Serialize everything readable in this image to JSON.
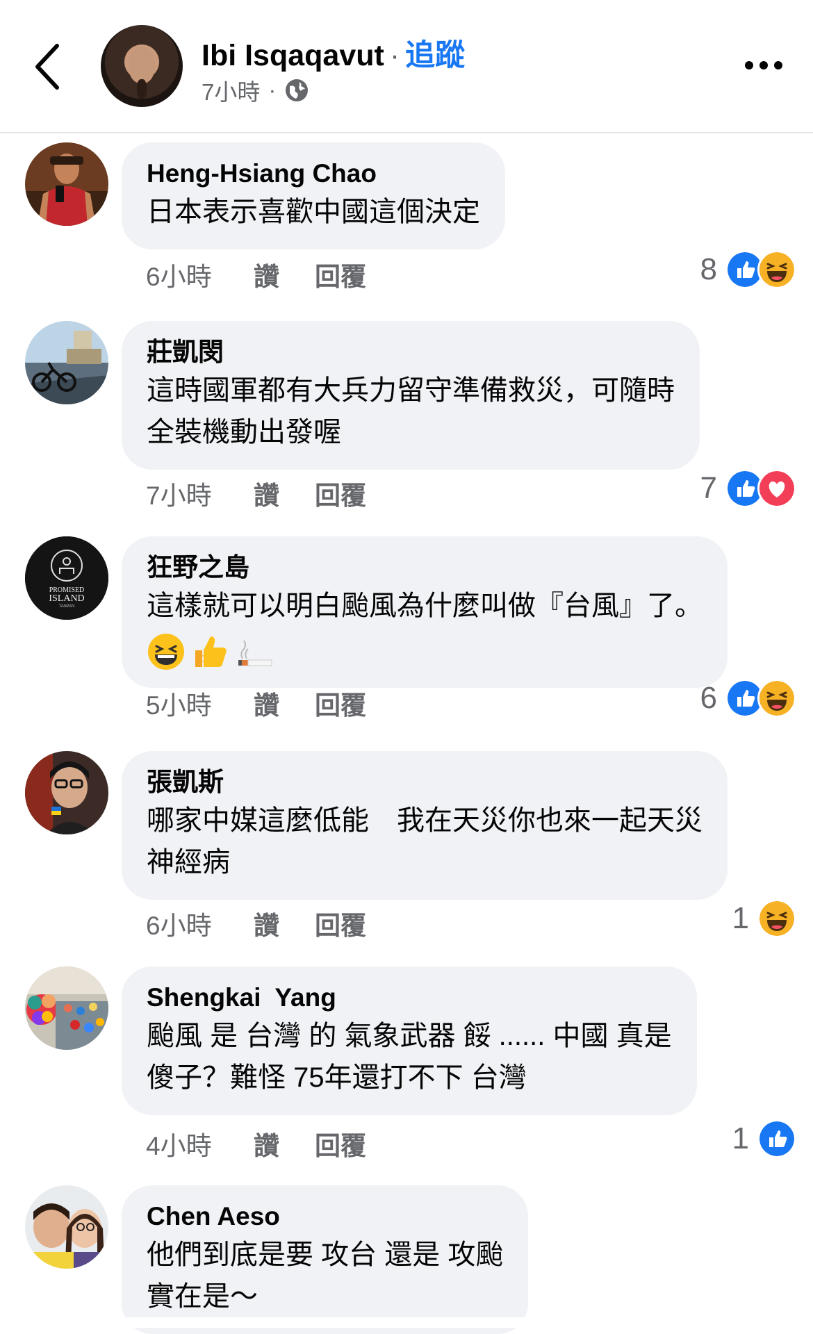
{
  "header": {
    "author": "Ibi Isqaqavut",
    "separator": "·",
    "follow_label": "追蹤",
    "time": "7小時",
    "meta_separator": "·"
  },
  "colors": {
    "accent": "#1877f2",
    "secondary_text": "#65676b",
    "bubble_bg": "#f0f2f5",
    "love_red": "#f33e58",
    "haha_yellow": "#f7b125"
  },
  "comments": [
    {
      "author": "Heng-Hsiang Chao",
      "lines": [
        "日本表示喜歡中國這個決定"
      ],
      "time": "6小時",
      "like_label": "讚",
      "reply_label": "回覆",
      "reaction_count": "8",
      "reactions": [
        "like-icon",
        "haha-icon"
      ]
    },
    {
      "author": "莊凱閔",
      "lines": [
        "這時國軍都有大兵力留守準備救災，可隨時",
        "全裝機動出發喔"
      ],
      "time": "7小時",
      "like_label": "讚",
      "reply_label": "回覆",
      "reaction_count": "7",
      "reactions": [
        "like-icon",
        "love-icon"
      ]
    },
    {
      "author": "狂野之島",
      "avatar_logo": {
        "line1": "PROMISED",
        "line2": "ISLAND",
        "line3": "TAIWAN"
      },
      "lines": [
        "這樣就可以明白颱風為什麼叫做『台風』了。"
      ],
      "emojis": [
        "laughing-emoji-icon",
        "thumbs-up-emoji-icon",
        "cigarette-emoji-icon"
      ],
      "time": "5小時",
      "like_label": "讚",
      "reply_label": "回覆",
      "reaction_count": "6",
      "reactions": [
        "like-icon",
        "haha-icon"
      ]
    },
    {
      "author": "張凱斯",
      "lines": [
        "哪家中媒這麼低能　我在天災你也來一起天災",
        "神經病"
      ],
      "time": "6小時",
      "like_label": "讚",
      "reply_label": "回覆",
      "reaction_count": "1",
      "reactions": [
        "haha-icon"
      ]
    },
    {
      "author": "Shengkai  Yang",
      "lines": [
        "颱風 是 台灣 的 氣象武器 餒 ...... 中國 真是",
        "傻子？難怪 75年還打不下 台灣"
      ],
      "time": "4小時",
      "like_label": "讚",
      "reply_label": "回覆",
      "reaction_count": "1",
      "reactions": [
        "like-icon"
      ]
    },
    {
      "author": "Chen Aeso",
      "lines": [
        "他們到底是要 攻台 還是 攻颱",
        "實在是～"
      ]
    }
  ]
}
